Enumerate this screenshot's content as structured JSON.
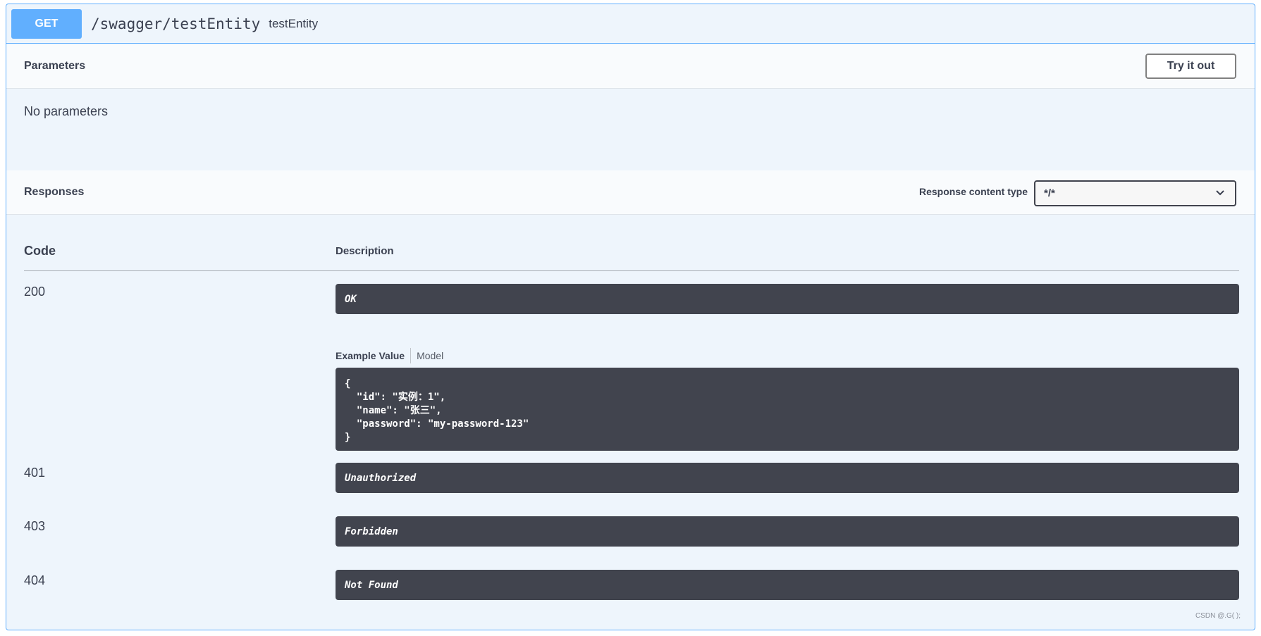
{
  "operation": {
    "method": "GET",
    "path": "/swagger/testEntity",
    "description": "testEntity"
  },
  "parameters": {
    "title": "Parameters",
    "try_button": "Try it out",
    "empty_text": "No parameters"
  },
  "responses": {
    "title": "Responses",
    "content_type_label": "Response content type",
    "content_type_value": "*/*",
    "table_headers": {
      "code": "Code",
      "description": "Description"
    },
    "items": [
      {
        "code": "200",
        "description": "OK"
      },
      {
        "code": "401",
        "description": "Unauthorized"
      },
      {
        "code": "403",
        "description": "Forbidden"
      },
      {
        "code": "404",
        "description": "Not Found"
      }
    ],
    "example_tabs": {
      "active": "Example Value",
      "inactive": "Model"
    },
    "example_lines": [
      "{",
      "  \"id\": \"实例：1\",",
      "  \"name\": \"张三\",",
      "  \"password\": \"my-password-123\"",
      "}"
    ]
  },
  "watermark": "CSDN @.G( );",
  "colors": {
    "get_accent": "#61affe",
    "panel_bg": "#eef5fc",
    "dark_box": "#41444e",
    "text": "#3b4151"
  }
}
